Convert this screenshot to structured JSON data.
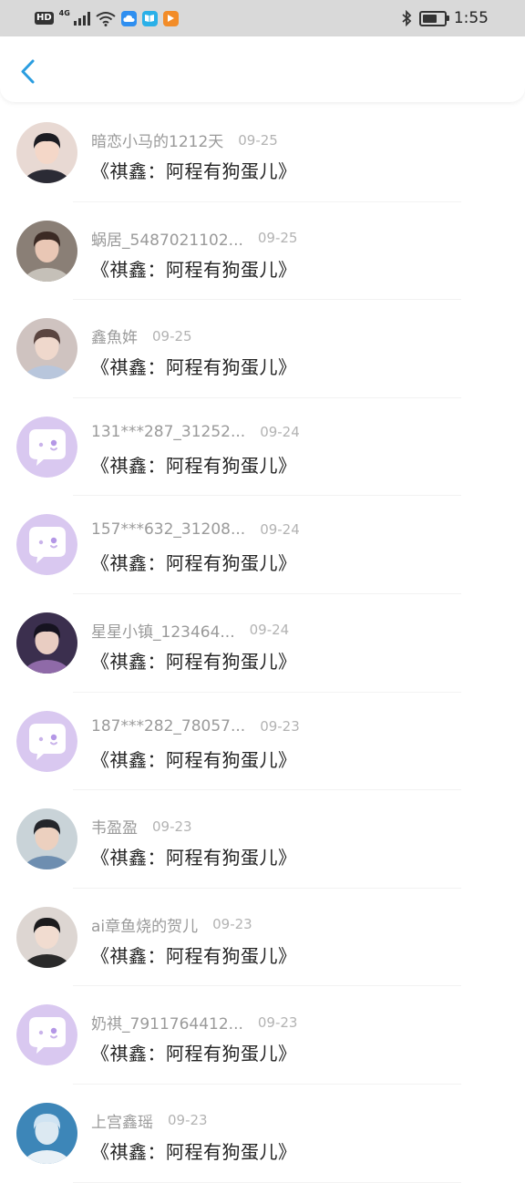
{
  "status_bar": {
    "hd_badge": "HD",
    "network": "4G",
    "time": "1:55",
    "battery_level": 0.7
  },
  "header": {
    "back_icon": "chevron-left-icon",
    "accent_color": "#2a9de0"
  },
  "messages": [
    {
      "name": "暗恋小马的1212天",
      "date": "09-25",
      "text": "《祺鑫：阿程有狗蛋儿》",
      "avatar": "photo"
    },
    {
      "name": "蜗居_5487021102...",
      "date": "09-25",
      "text": "《祺鑫：阿程有狗蛋儿》",
      "avatar": "photo"
    },
    {
      "name": "鑫魚姩",
      "date": "09-25",
      "text": "《祺鑫：阿程有狗蛋儿》",
      "avatar": "photo"
    },
    {
      "name": "131***287_31252...",
      "date": "09-24",
      "text": "《祺鑫：阿程有狗蛋儿》",
      "avatar": "default"
    },
    {
      "name": "157***632_31208...",
      "date": "09-24",
      "text": "《祺鑫：阿程有狗蛋儿》",
      "avatar": "default"
    },
    {
      "name": "星星小镇_123464...",
      "date": "09-24",
      "text": "《祺鑫：阿程有狗蛋儿》",
      "avatar": "photo"
    },
    {
      "name": "187***282_78057...",
      "date": "09-23",
      "text": "《祺鑫：阿程有狗蛋儿》",
      "avatar": "default"
    },
    {
      "name": "韦盈盈",
      "date": "09-23",
      "text": "《祺鑫：阿程有狗蛋儿》",
      "avatar": "photo"
    },
    {
      "name": "ai章鱼烧的贺儿",
      "date": "09-23",
      "text": "《祺鑫：阿程有狗蛋儿》",
      "avatar": "photo"
    },
    {
      "name": "奶祺_7911764412...",
      "date": "09-23",
      "text": "《祺鑫：阿程有狗蛋儿》",
      "avatar": "default"
    },
    {
      "name": "上宫鑫瑶",
      "date": "09-23",
      "text": "《祺鑫：阿程有狗蛋儿》",
      "avatar": "photo"
    }
  ]
}
